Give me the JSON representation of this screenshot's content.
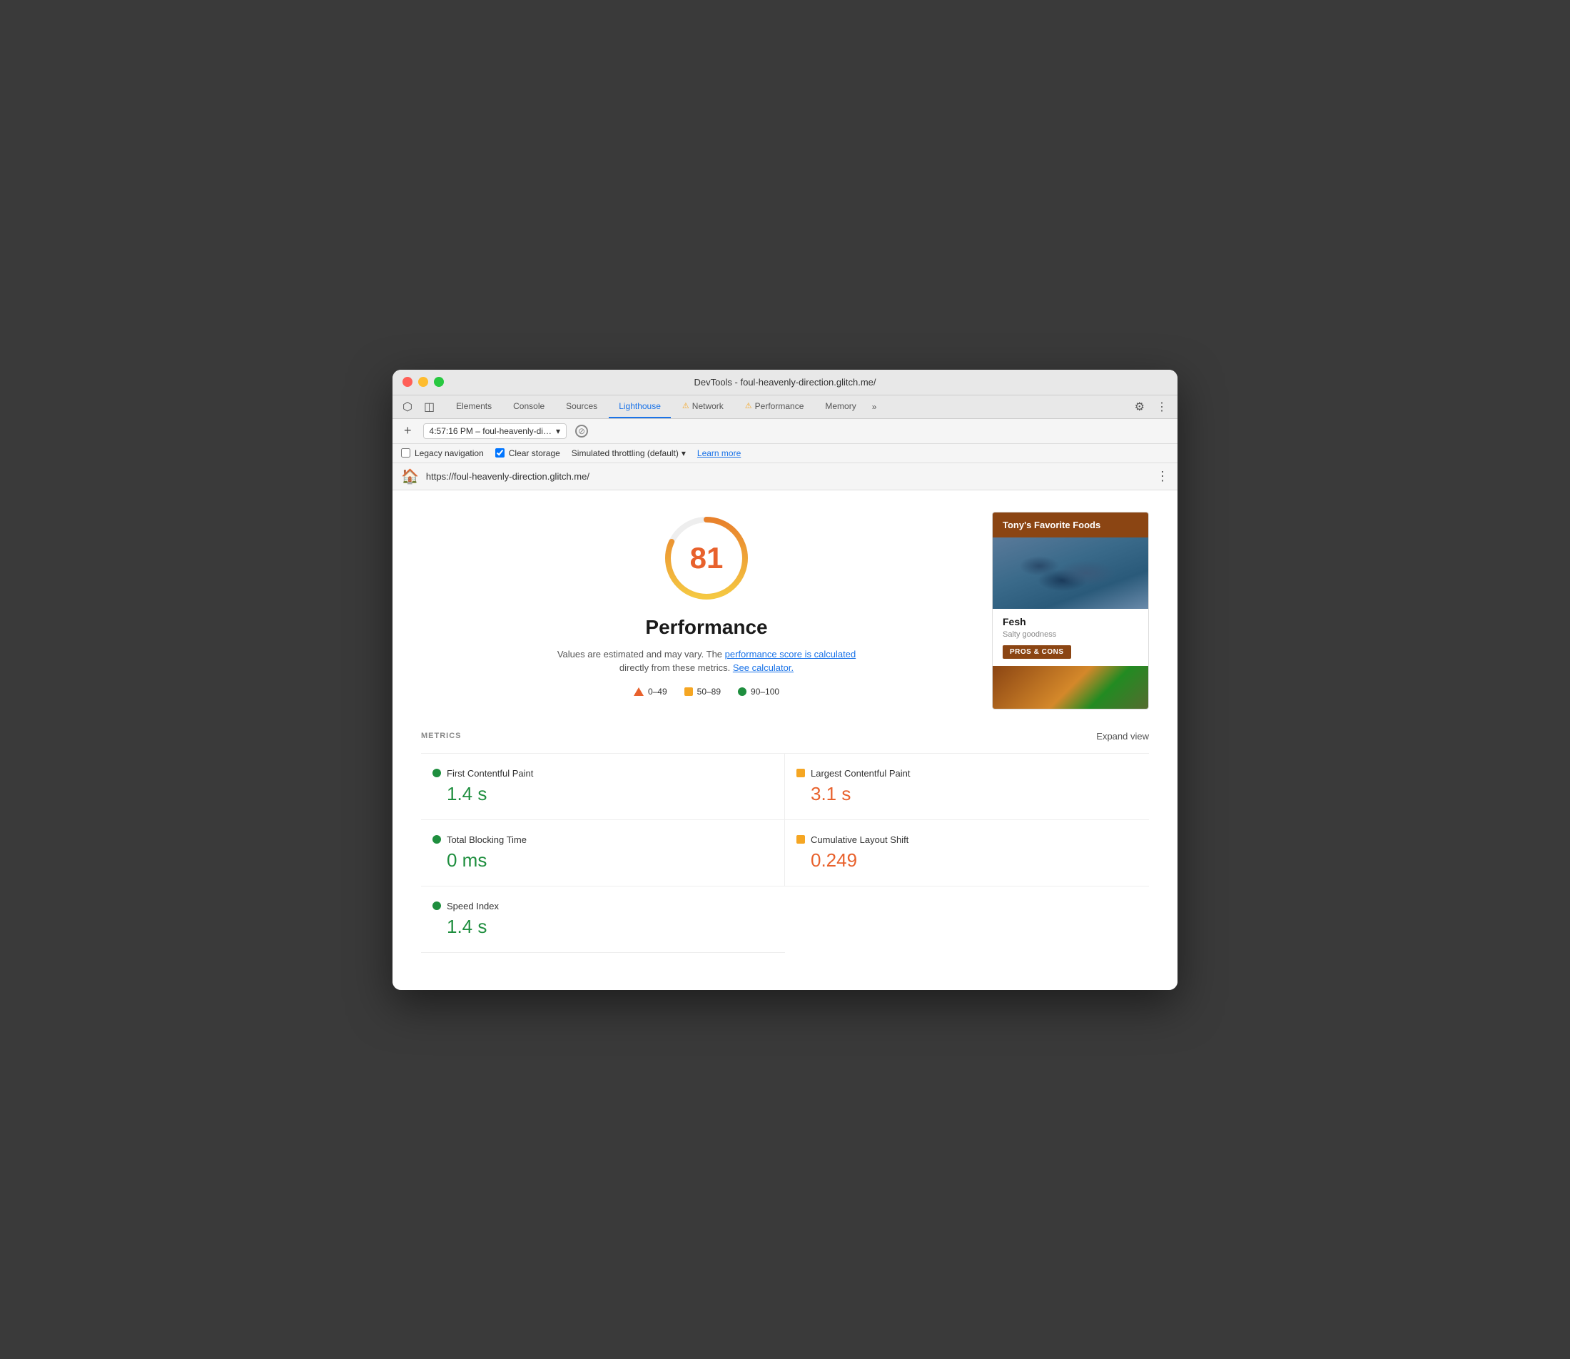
{
  "window": {
    "title": "DevTools - foul-heavenly-direction.glitch.me/"
  },
  "tabs": {
    "items": [
      {
        "id": "elements",
        "label": "Elements",
        "active": false,
        "warning": false
      },
      {
        "id": "console",
        "label": "Console",
        "active": false,
        "warning": false
      },
      {
        "id": "sources",
        "label": "Sources",
        "active": false,
        "warning": false
      },
      {
        "id": "lighthouse",
        "label": "Lighthouse",
        "active": true,
        "warning": false
      },
      {
        "id": "network",
        "label": "Network",
        "active": false,
        "warning": true
      },
      {
        "id": "performance",
        "label": "Performance",
        "active": false,
        "warning": true
      },
      {
        "id": "memory",
        "label": "Memory",
        "active": false,
        "warning": false
      }
    ],
    "more_label": "»"
  },
  "session": {
    "label": "4:57:16 PM – foul-heavenly-di…",
    "placeholder": "4:57:16 PM – foul-heavenly-di…"
  },
  "options": {
    "legacy_navigation": {
      "label": "Legacy navigation",
      "checked": false
    },
    "clear_storage": {
      "label": "Clear storage",
      "checked": true
    },
    "throttling": {
      "label": "Simulated throttling (default)"
    },
    "learn_more": "Learn more"
  },
  "url_bar": {
    "url": "https://foul-heavenly-direction.glitch.me/"
  },
  "score_section": {
    "score": "81",
    "title": "Performance",
    "subtitle_text": "Values are estimated and may vary. The ",
    "link1_text": "performance score is calculated",
    "subtitle_mid": " directly from these metrics. ",
    "link2_text": "See calculator.",
    "legend": [
      {
        "type": "triangle",
        "label": "0–49"
      },
      {
        "type": "square",
        "label": "50–89"
      },
      {
        "type": "dot",
        "label": "90–100",
        "color": "#1e8e3e"
      }
    ]
  },
  "preview_card": {
    "header": "Tony's Favorite Foods",
    "item_name": "Fesh",
    "item_desc": "Salty goodness",
    "button_label": "PROS & CONS"
  },
  "metrics": {
    "section_label": "METRICS",
    "expand_label": "Expand view",
    "items": [
      {
        "id": "fcp",
        "name": "First Contentful Paint",
        "value": "1.4 s",
        "indicator": "dot",
        "color": "green"
      },
      {
        "id": "lcp",
        "name": "Largest Contentful Paint",
        "value": "3.1 s",
        "indicator": "square",
        "color": "orange"
      },
      {
        "id": "tbt",
        "name": "Total Blocking Time",
        "value": "0 ms",
        "indicator": "dot",
        "color": "green"
      },
      {
        "id": "cls",
        "name": "Cumulative Layout Shift",
        "value": "0.249",
        "indicator": "square",
        "color": "orange"
      },
      {
        "id": "si",
        "name": "Speed Index",
        "value": "1.4 s",
        "indicator": "dot",
        "color": "green"
      }
    ]
  },
  "icons": {
    "cursor": "⬡",
    "layers": "◫",
    "gear": "⚙",
    "dots_vertical": "⋮",
    "chevron_down": "▾",
    "add": "+",
    "block": "⊘"
  }
}
